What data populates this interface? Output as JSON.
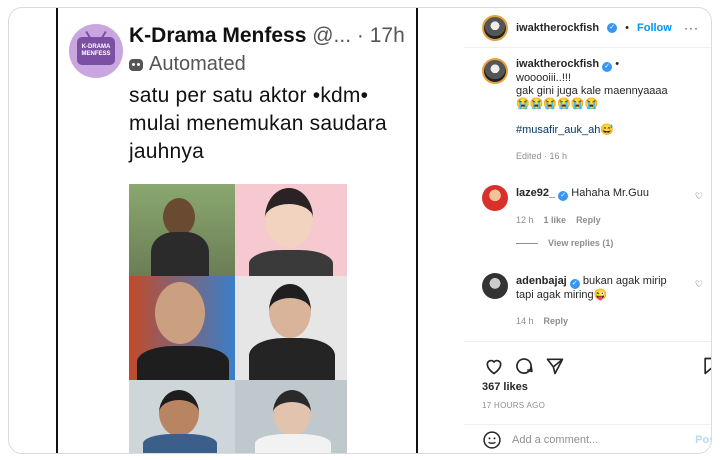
{
  "tweet": {
    "display_name": "K-Drama Menfess",
    "handle": " @...",
    "time": " · 17h",
    "automated_label": "Automated",
    "text": "satu per satu aktor •kdm• mulai menemukan saudara jauhnya",
    "avatar_text": "K-DRAMA MENFESS"
  },
  "header": {
    "username": "iwaktherockfish",
    "follow_label": "Follow",
    "separator": "•",
    "more_label": "···"
  },
  "caption": {
    "username": "iwaktherockfish",
    "separator": "•",
    "line1": "wooooiii..!!!",
    "line2": "gak gini juga kale maennyaaaa",
    "emojis": "😭😭😭😭😭😭",
    "hashtag": "#musafir_auk_ah😅",
    "meta": "Edited · 16 h"
  },
  "comments": [
    {
      "username": "laze92_",
      "text": "Hahaha Mr.Guu",
      "age": "12 h",
      "likes": "1 like",
      "reply": "Reply"
    },
    {
      "username": "adenbajaj",
      "text": "bukan agak mirip tapi agak miring😜",
      "age": "14 h",
      "reply": "Reply"
    }
  ],
  "view_replies": "View replies (1)",
  "likes_count": "367 likes",
  "posted_ago": "17 HOURS AGO",
  "composer": {
    "placeholder": "Add a comment...",
    "post_label": "Post"
  },
  "colors": {
    "link_blue": "#0095f6",
    "verified_blue": "#3897f0",
    "muted": "#8e8e8e"
  }
}
